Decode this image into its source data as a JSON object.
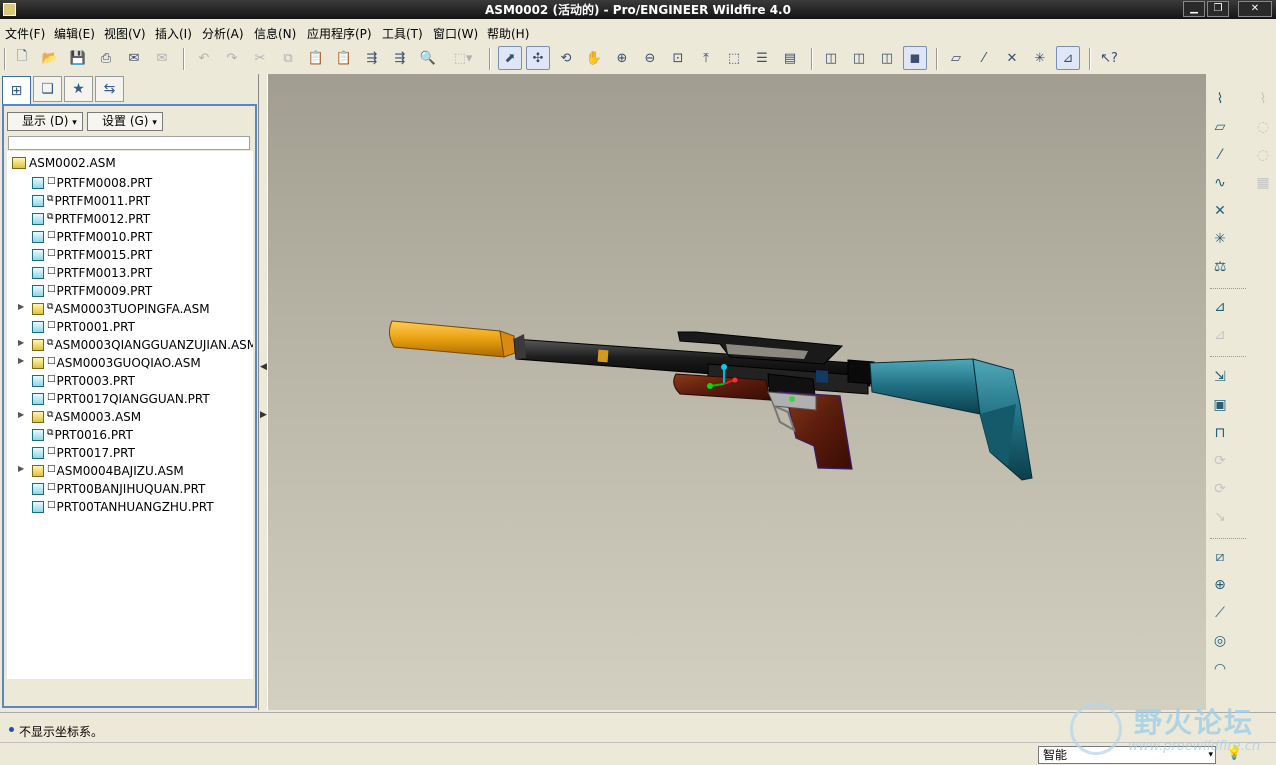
{
  "window": {
    "title": "ASM0002 (活动的) - Pro/ENGINEER Wildfire 4.0",
    "controls": {
      "minimize": "▁",
      "maximize": "❐",
      "close": "✕"
    }
  },
  "menu": {
    "items": [
      "文件(F)",
      "编辑(E)",
      "视图(V)",
      "插入(I)",
      "分析(A)",
      "信息(N)",
      "应用程序(P)",
      "工具(T)",
      "窗口(W)",
      "帮助(H)"
    ]
  },
  "toolbar": {
    "icons": [
      "new-icon",
      "open-icon",
      "save-icon",
      "print-icon",
      "send-mail-icon",
      "mail-attach-icon",
      "undo-icon",
      "redo-icon",
      "cut-icon",
      "copy-icon",
      "paste-icon",
      "paste-special-icon",
      "regenerate-icon",
      "regen-manager-icon",
      "find-icon",
      "select-box-icon",
      "datum-display-icon",
      "spin-center-icon",
      "orient-icon",
      "pan-icon",
      "zoom-in-icon",
      "zoom-out-icon",
      "refit-icon",
      "reorient-icon",
      "saved-views-icon",
      "layers-icon",
      "view-manager-icon",
      "wireframe-icon",
      "hidden-line-icon",
      "no-hidden-icon",
      "shading-icon",
      "datum-planes-icon",
      "datum-axes-icon",
      "datum-points-icon",
      "coord-sys-icon",
      "annotations-icon",
      "context-help-icon"
    ]
  },
  "left_panel": {
    "tabs": [
      "model-tree-tab",
      "layer-tab",
      "favorites-tab",
      "connections-tab"
    ],
    "display_dropdown": "显示 (D)",
    "settings_dropdown": "设置 (G)",
    "tree": [
      {
        "label": "ASM0002.ASM",
        "type": "root"
      },
      {
        "label": "PRTFM0008.PRT",
        "type": "prt"
      },
      {
        "label": "PRTFM0011.PRT",
        "type": "prt"
      },
      {
        "label": "PRTFM0012.PRT",
        "type": "prt"
      },
      {
        "label": "PRTFM0010.PRT",
        "type": "prt"
      },
      {
        "label": "PRTFM0015.PRT",
        "type": "prt"
      },
      {
        "label": "PRTFM0013.PRT",
        "type": "prt"
      },
      {
        "label": "PRTFM0009.PRT",
        "type": "prt"
      },
      {
        "label": "ASM0003TUOPINGFA.ASM",
        "type": "asm"
      },
      {
        "label": "PRT0001.PRT",
        "type": "prt"
      },
      {
        "label": "ASM0003QIANGGUANZUJIAN.ASM",
        "type": "asm"
      },
      {
        "label": "ASM0003GUOQIAO.ASM",
        "type": "asm"
      },
      {
        "label": "PRT0003.PRT",
        "type": "prt"
      },
      {
        "label": "PRT0017QIANGGUAN.PRT",
        "type": "prt"
      },
      {
        "label": "ASM0003.ASM",
        "type": "asm"
      },
      {
        "label": "PRT0016.PRT",
        "type": "prt"
      },
      {
        "label": "PRT0017.PRT",
        "type": "prt"
      },
      {
        "label": "ASM0004BAJIZU.ASM",
        "type": "asm"
      },
      {
        "label": "PRT00BANJIHUQUAN.PRT",
        "type": "prt"
      },
      {
        "label": "PRT00TANHUANGZHU.PRT",
        "type": "prt"
      }
    ],
    "scroll_thumb_glyph": "<>"
  },
  "right_tools": {
    "icons": [
      "sketch-tool-icon",
      "datum-plane-icon",
      "datum-axis-icon",
      "datum-curve-icon",
      "datum-point-icon",
      "coord-sys-tool-icon",
      "analysis-feature-icon",
      "assemble-icon",
      "create-component-icon",
      "repeat-icon",
      "pattern-icon",
      "mirror-icon",
      "rotate-icon",
      "rotate2-icon",
      "extrude-icon",
      "revolve-icon",
      "sweep-icon",
      "hole-icon",
      "round-icon"
    ]
  },
  "messages": {
    "last": "不显示坐标系。"
  },
  "status": {
    "filter": "智能"
  },
  "watermark": {
    "line1": "野火论坛",
    "line2": "www.proewildfire.cn"
  }
}
